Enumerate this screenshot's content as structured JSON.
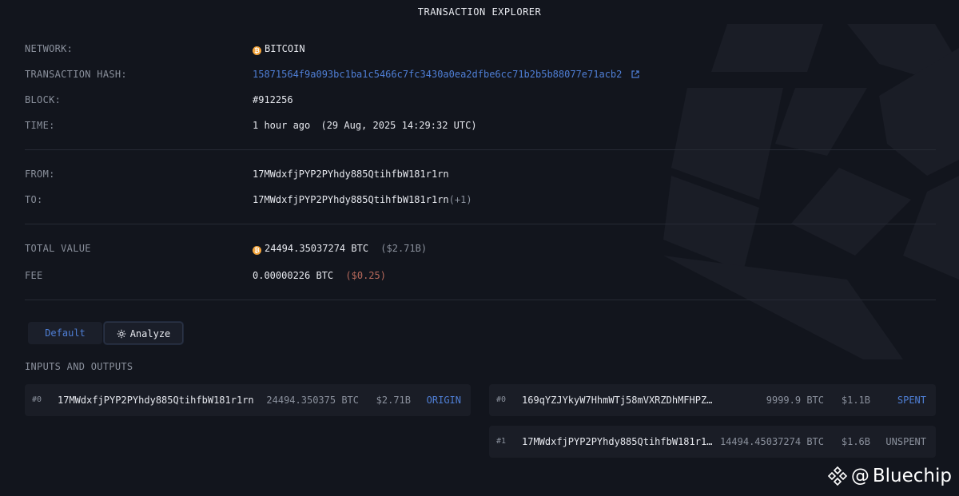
{
  "header": {
    "title": "TRANSACTION EXPLORER"
  },
  "details": {
    "network_label": "NETWORK:",
    "network_value": "BITCOIN",
    "hash_label": "TRANSACTION HASH:",
    "hash_value": "15871564f9a093bc1ba1c5466c7fc3430a0ea2dfbe6cc71b2b5b88077e71acb2",
    "block_label": "BLOCK:",
    "block_value": "#912256",
    "time_label": "TIME:",
    "time_relative": "1 hour ago",
    "time_absolute": "(29 Aug, 2025 14:29:32 UTC)"
  },
  "parties": {
    "from_label": "FROM:",
    "from_value": "17MWdxfjPYP2PYhdy885QtihfbW181r1rn",
    "to_label": "TO:",
    "to_value": "17MWdxfjPYP2PYhdy885QtihfbW181r1rn",
    "to_extra": "(+1)"
  },
  "value": {
    "total_label": "TOTAL VALUE",
    "total_btc": "24494.35037274 BTC",
    "total_usd": "($2.71B)",
    "fee_label": "FEE",
    "fee_btc": "0.00000226 BTC",
    "fee_usd": "($0.25)"
  },
  "tabs": {
    "default_label": "Default",
    "analyze_label": "Analyze"
  },
  "io_section": {
    "title": "INPUTS AND OUTPUTS",
    "inputs": [
      {
        "index": "#0",
        "address": "17MWdxfjPYP2PYhdy885QtihfbW181r1rn",
        "amount": "24494.350375 BTC",
        "usd": "$2.71B",
        "status": "ORIGIN"
      }
    ],
    "outputs": [
      {
        "index": "#0",
        "address": "169qYZJYkyW7HhmWTj58mVXRZDhMFHPZ…",
        "amount": "9999.9 BTC",
        "usd": "$1.1B",
        "status": "SPENT"
      },
      {
        "index": "#1",
        "address": "17MWdxfjPYP2PYhdy885QtihfbW181r1…",
        "amount": "14494.45037274 BTC",
        "usd": "$1.6B",
        "status": "UNSPENT"
      }
    ]
  },
  "watermark": {
    "at": "@",
    "name": "Bluechip"
  },
  "colors": {
    "accent": "#4f7fd6",
    "bitcoin": "#f2a33a",
    "background": "#12151d",
    "fee_usd": "#b86a5c"
  },
  "icons": {
    "network": "bitcoin-icon",
    "external": "external-link-icon",
    "analyze": "gear-icon",
    "brand": "binance-icon"
  }
}
